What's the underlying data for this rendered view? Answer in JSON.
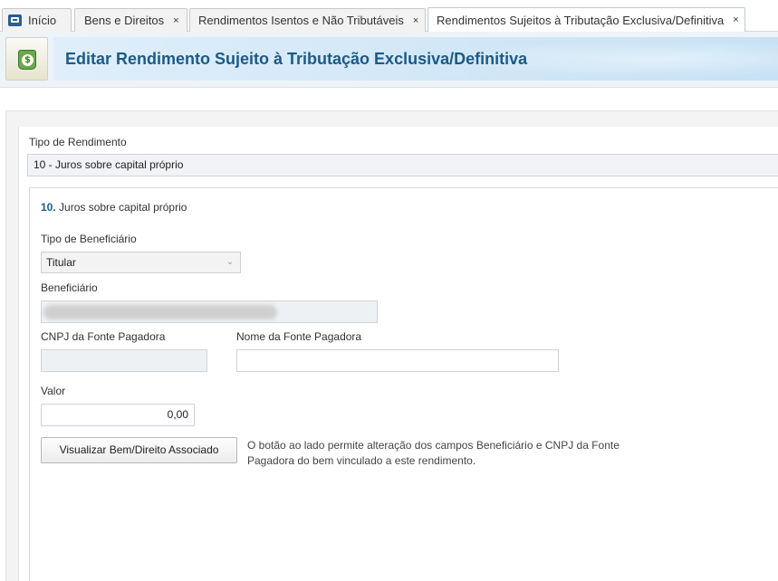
{
  "tabs": [
    {
      "label": "Início",
      "icon": "receita-home-icon",
      "closable": false
    },
    {
      "label": "Bens e Direitos",
      "closable": true
    },
    {
      "label": "Rendimentos Isentos e Não Tributáveis",
      "closable": true
    },
    {
      "label": "Rendimentos Sujeitos à Tributação Exclusiva/Definitiva",
      "closable": true,
      "active": true
    }
  ],
  "tab_close_glyph": "×",
  "header": {
    "icon": "money-document-icon",
    "title": "Editar Rendimento Sujeito à Tributação Exclusiva/Definitiva"
  },
  "form": {
    "tipo_rendimento_label": "Tipo de Rendimento",
    "tipo_rendimento_value": "10 - Juros sobre capital próprio",
    "section_number": "10.",
    "section_title": "Juros sobre capital próprio",
    "tipo_beneficiario_label": "Tipo de Beneficiário",
    "tipo_beneficiario_value": "Titular",
    "beneficiario_label": "Beneficiário",
    "cnpj_label": "CNPJ da Fonte Pagadora",
    "cnpj_value": "",
    "nome_fonte_label": "Nome da Fonte Pagadora",
    "nome_fonte_value": "",
    "valor_label": "Valor",
    "valor_value": "0,00",
    "visualizar_button": "Visualizar Bem/Direito Associado",
    "hint_text": "O botão ao lado permite alteração dos campos Beneficiário e CNPJ da Fonte Pagadora do bem vinculado a este rendimento."
  },
  "colors": {
    "title_blue": "#1d5a86",
    "header_gradient_start": "#dfeefa",
    "header_gradient_end": "#c6e1f5"
  }
}
